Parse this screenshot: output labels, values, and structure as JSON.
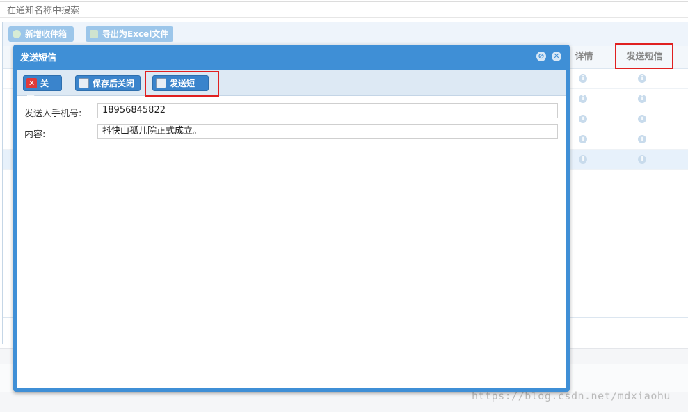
{
  "search": {
    "placeholder": "在通知名称中搜索"
  },
  "grid_toolbar": {
    "add_label": "新增收件箱",
    "export_label": "导出为Excel文件"
  },
  "grid": {
    "headers": {
      "details": "详情",
      "send_sms": "发送短信"
    },
    "info_glyph": "i"
  },
  "dialog": {
    "title": "发送短信",
    "toolbar": {
      "close_label": "关闭",
      "save_close_label": "保存后关闭",
      "send_sms_label": "发送短信"
    },
    "form": {
      "phone_label": "发送人手机号:",
      "phone_value": "18956845822",
      "content_label": "内容:",
      "content_value": "抖快山孤儿院正式成立。"
    }
  },
  "watermark": "https://blog.csdn.net/mdxiaohu",
  "colors": {
    "accent": "#3f8fd6",
    "highlight": "#e02020"
  }
}
